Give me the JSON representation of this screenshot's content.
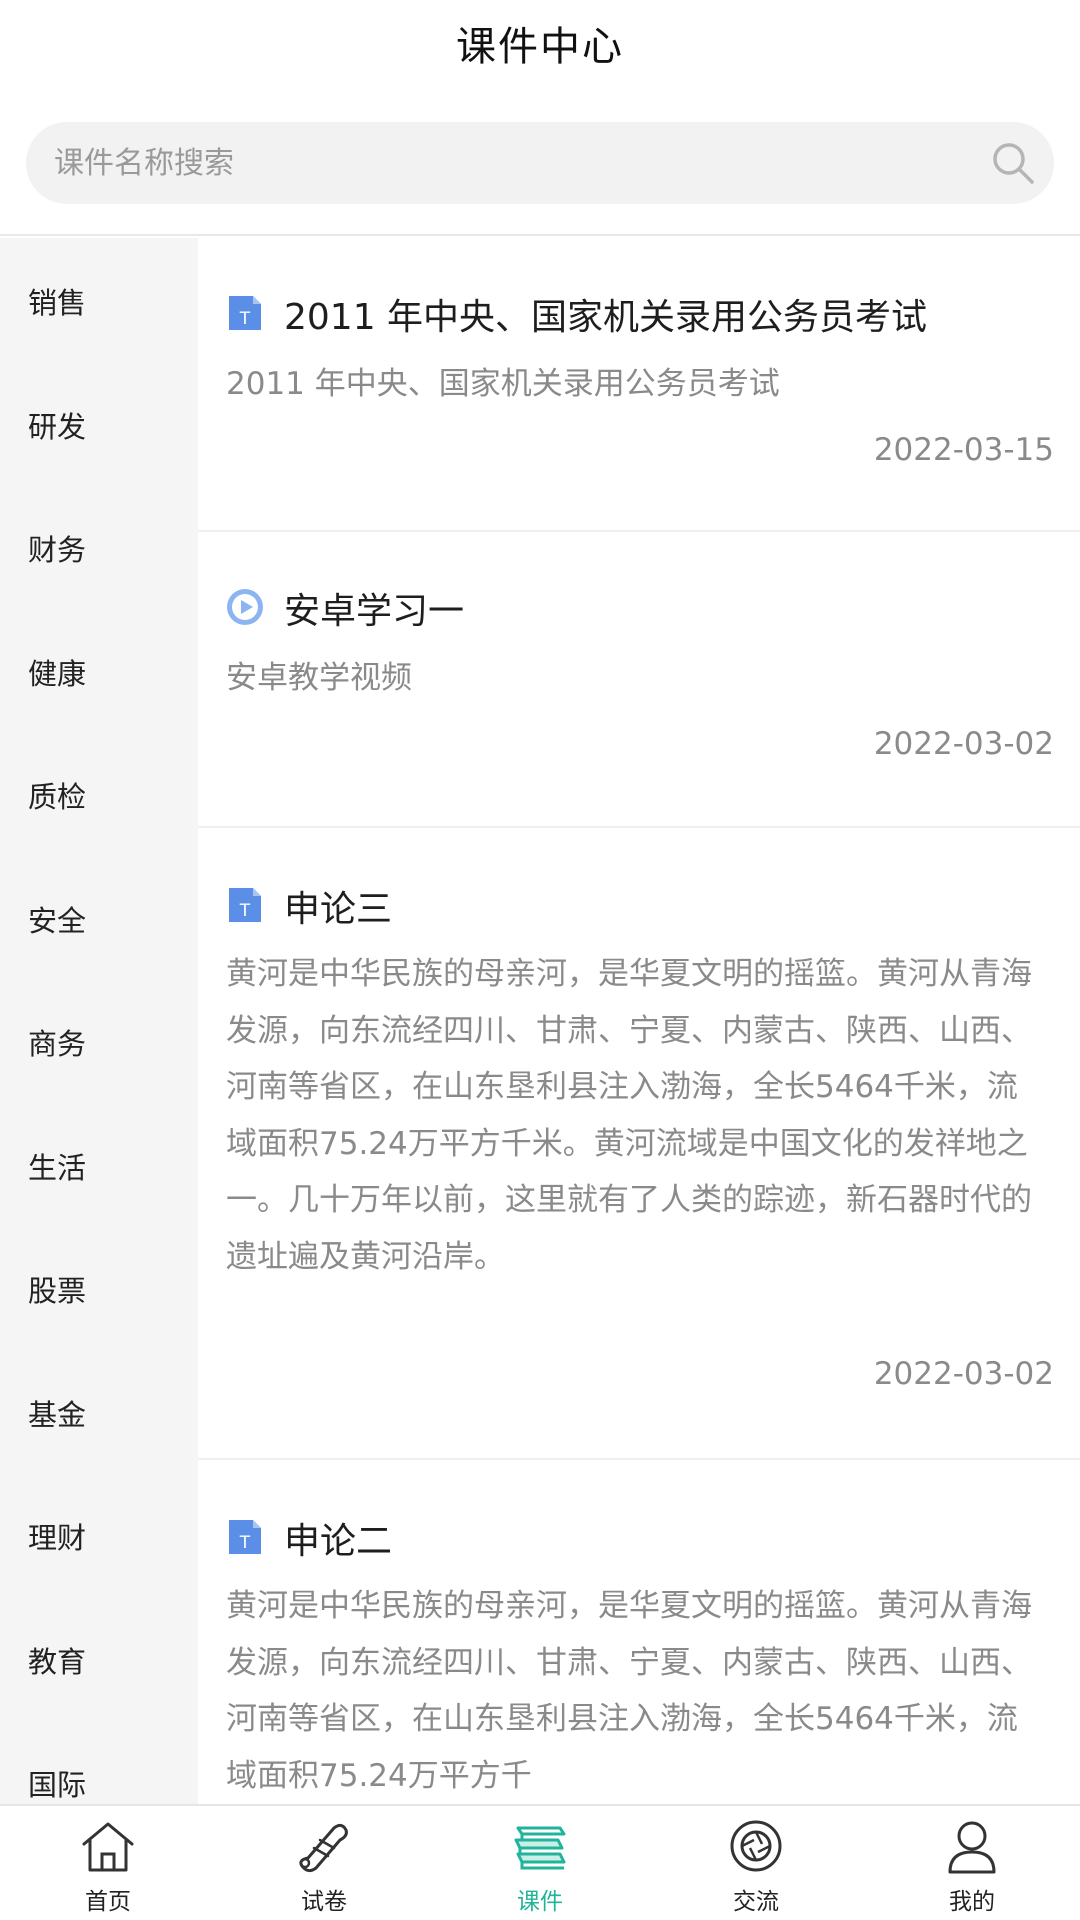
{
  "header": {
    "title": "课件中心"
  },
  "search": {
    "placeholder": "课件名称搜索"
  },
  "sidebar": {
    "items": [
      "销售",
      "研发",
      "财务",
      "健康",
      "质检",
      "安全",
      "商务",
      "生活",
      "股票",
      "基金",
      "理财",
      "教育",
      "国际"
    ]
  },
  "courses": [
    {
      "icon": "document-icon",
      "title": "2011 年中央、国家机关录用公务员考试",
      "desc": "2011 年中央、国家机关录用公务员考试",
      "date": "2022-03-15"
    },
    {
      "icon": "video-play-icon",
      "title": "安卓学习一",
      "desc": "安卓教学视频",
      "date": "2022-03-02"
    },
    {
      "icon": "document-icon",
      "title": "申论三",
      "desc": "黄河是中华民族的母亲河，是华夏文明的摇篮。黄河从青海发源，向东流经四川、甘肃、宁夏、内蒙古、陕西、山西、河南等省区，在山东垦利县注入渤海，全长5464千米，流域面积75.24万平方千米。黄河流域是中国文化的发祥地之一。几十万年以前，这里就有了人类的踪迹，新石器时代的遗址遍及黄河沿岸。",
      "date": "2022-03-02"
    },
    {
      "icon": "document-icon",
      "title": "申论二",
      "desc": "黄河是中华民族的母亲河，是华夏文明的摇篮。黄河从青海发源，向东流经四川、甘肃、宁夏、内蒙古、陕西、山西、河南等省区，在山东垦利县注入渤海，全长5464千米，流域面积75.24万平方千",
      "date": ""
    }
  ],
  "tabbar": {
    "tabs": [
      {
        "label": "首页",
        "icon": "home-icon"
      },
      {
        "label": "试卷",
        "icon": "scroll-paper-icon"
      },
      {
        "label": "课件",
        "icon": "stack-books-icon",
        "active": true
      },
      {
        "label": "交流",
        "icon": "camera-shutter-icon"
      },
      {
        "label": "我的",
        "icon": "user-icon"
      }
    ]
  },
  "colors": {
    "accent": "#22b39b",
    "doc_icon": "#5b8ee6",
    "video_icon": "#8cb4f2",
    "muted_text": "#8a8a8a"
  }
}
